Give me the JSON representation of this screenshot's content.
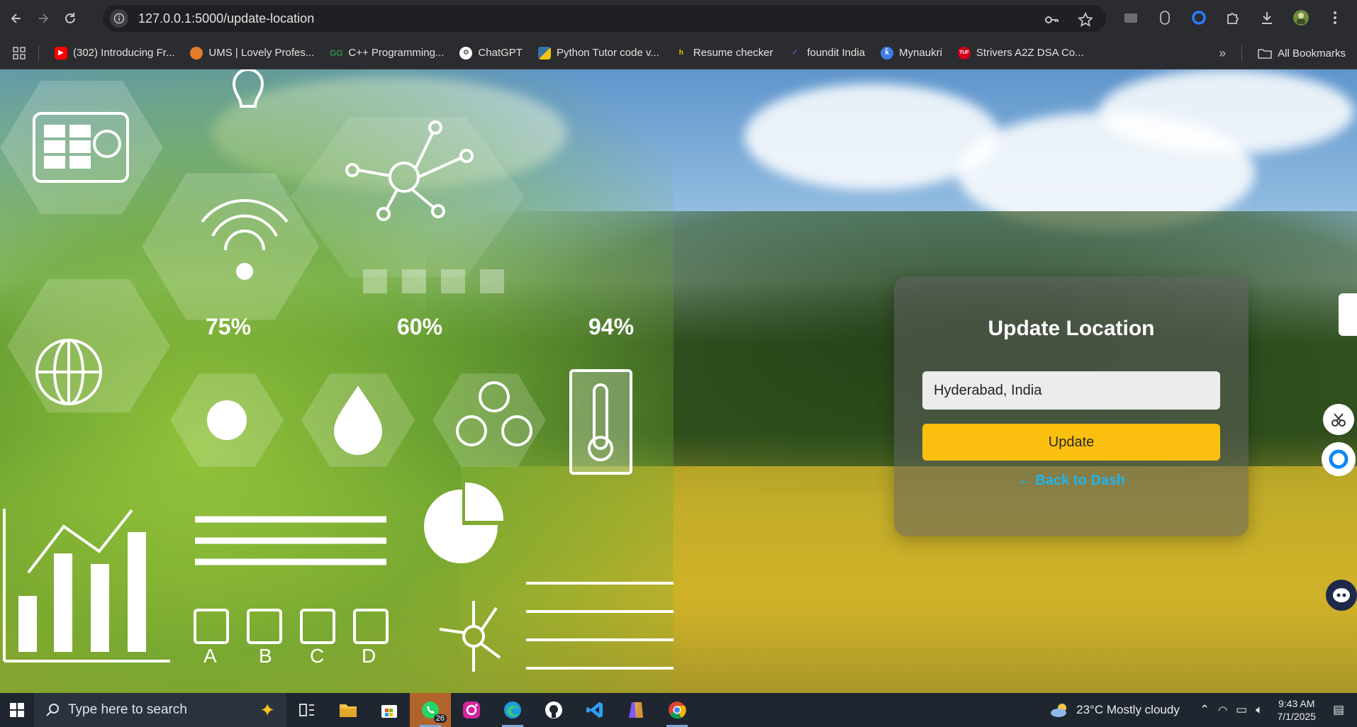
{
  "browser": {
    "url": "127.0.0.1:5000/update-location",
    "bookmarks": [
      {
        "label": "(302) Introducing Fr...",
        "color": "#ff0000",
        "icon": "youtube-icon"
      },
      {
        "label": "UMS | Lovely Profes...",
        "color": "#e37b2c",
        "icon": "ums-icon"
      },
      {
        "label": "C++ Programming...",
        "color": "#2f8d46",
        "icon": "gfg-icon"
      },
      {
        "label": "ChatGPT",
        "color": "#e3e3e3",
        "icon": "chatgpt-icon"
      },
      {
        "label": "Python Tutor code v...",
        "color": "#3572a5",
        "icon": "python-icon"
      },
      {
        "label": "Resume checker",
        "color": "#f2c40f",
        "icon": "resume-icon"
      },
      {
        "label": "foundit India",
        "color": "#6b3fa0",
        "icon": "foundit-icon"
      },
      {
        "label": "Mynaukri",
        "color": "#3f7de8",
        "icon": "naukri-icon"
      },
      {
        "label": "Strivers A2Z DSA Co...",
        "color": "#d0021b",
        "icon": "tuf-icon"
      }
    ],
    "all_bookmarks_label": "All Bookmarks"
  },
  "hero": {
    "percents": [
      "75%",
      "60%",
      "94%"
    ],
    "letters": [
      "A",
      "B",
      "C",
      "D"
    ]
  },
  "card": {
    "title": "Update Location",
    "location_value": "Hyderabad, India",
    "update_label": "Update",
    "back_label": "← Back to Dash"
  },
  "taskbar": {
    "search_placeholder": "Type here to search",
    "whatsapp_badge": "26",
    "weather": "23°C  Mostly cloudy",
    "time": "9:43 AM",
    "date": "7/1/2025"
  },
  "colors": {
    "accent_button": "#fbbf0f",
    "link": "#1fb4ee",
    "chrome_bg": "#2b2c2f",
    "taskbar_bg": "#1f2630"
  }
}
